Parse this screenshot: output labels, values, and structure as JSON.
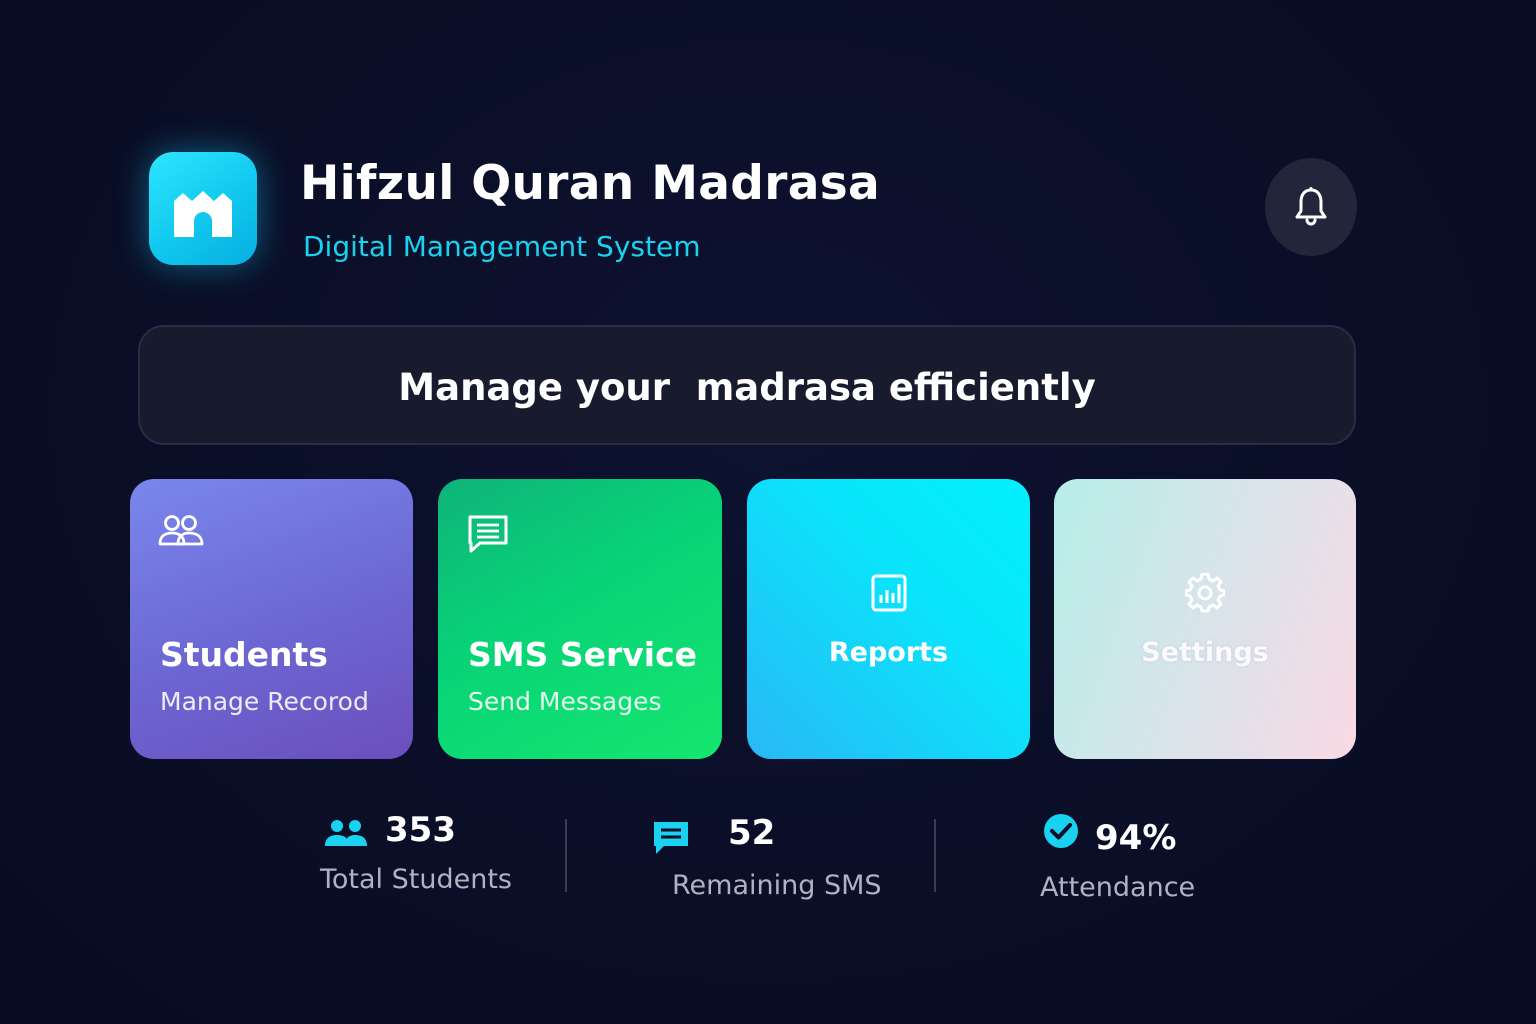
{
  "header": {
    "title": "Hifzul Quran Madrasa",
    "subtitle": "Digital Management System",
    "logo_icon": "mosque-icon",
    "notification_icon": "bell-icon"
  },
  "banner": {
    "text": "Manage your  madrasa efficiently"
  },
  "cards": [
    {
      "title": "Students",
      "subtitle": "Manage Recorod",
      "icon": "users-icon",
      "colors": [
        "#7a87ec",
        "#6b4fbd"
      ]
    },
    {
      "title": "SMS Service",
      "subtitle": "Send Messages",
      "icon": "message-icon",
      "colors": [
        "#0fb37a",
        "#15e66e"
      ]
    },
    {
      "title": "Reports",
      "icon": "chart-icon",
      "colors": [
        "#00f0ff",
        "#2ab8f6"
      ]
    },
    {
      "title": "Settings",
      "icon": "gear-icon",
      "colors": [
        "#b6eee9",
        "#f9d9e4"
      ]
    }
  ],
  "stats": [
    {
      "value": "353",
      "label": "Total Students",
      "icon": "users-icon"
    },
    {
      "value": "52",
      "label": "Remaining SMS",
      "icon": "message-icon"
    },
    {
      "value": "94%",
      "label": "Attendance",
      "icon": "check-circle-icon"
    }
  ],
  "colors": {
    "background": "#0a0e27",
    "accent": "#19d2f0",
    "banner_bg": "#181a2e",
    "label_gray": "#aeb3c2"
  }
}
